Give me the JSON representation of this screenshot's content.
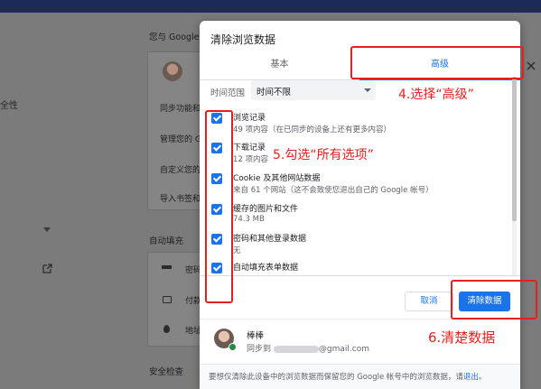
{
  "background": {
    "left_label": "全性",
    "section_title": "您与 Google",
    "card_rows": [
      "同步功能和",
      "管理您的 G",
      "自定义您的",
      "导入书签和"
    ],
    "autofill_heading": "自动填充",
    "autofill_rows": [
      "密码",
      "付款",
      "地址"
    ],
    "security_heading": "安全检查"
  },
  "dialog": {
    "title": "清除浏览数据",
    "tabs": [
      {
        "label": "基本",
        "active": false
      },
      {
        "label": "高级",
        "active": true
      }
    ],
    "time_range": {
      "label": "时间范围",
      "value": "时间不限"
    },
    "items": [
      {
        "title": "浏览记录",
        "subtitle": "49 项内容（在已同步的设备上还有更多内容）",
        "checked": true
      },
      {
        "title": "下载记录",
        "subtitle": "12 项内容",
        "checked": true
      },
      {
        "title": "Cookie 及其他网站数据",
        "subtitle": "来自 61 个网站（这不会致使您退出自己的 Google 帐号）",
        "checked": true
      },
      {
        "title": "缓存的图片和文件",
        "subtitle": "74.3 MB",
        "checked": true
      },
      {
        "title": "密码和其他登录数据",
        "subtitle": "无",
        "checked": true
      },
      {
        "title": "自动填充表单数据",
        "subtitle": "",
        "checked": true
      }
    ],
    "buttons": {
      "cancel": "取消",
      "clear": "清除数据"
    },
    "account": {
      "name": "棒棒",
      "sync_prefix": "同步到",
      "email_suffix": "@gmail.com"
    },
    "footer": {
      "text": "要想仅清除此设备中的浏览数据而保留您的 Google 帐号中的浏览数据，请",
      "link": "退出",
      "end": "。"
    }
  },
  "annotations": {
    "step4": "4.选择“高级”",
    "step5": "5.勾选“所有选项”",
    "step6": "6.清楚数据",
    "color": "#e62020"
  },
  "colors": {
    "accent": "#1a73e8",
    "overlay": "#7b7b7b",
    "annotation": "#e62020"
  }
}
